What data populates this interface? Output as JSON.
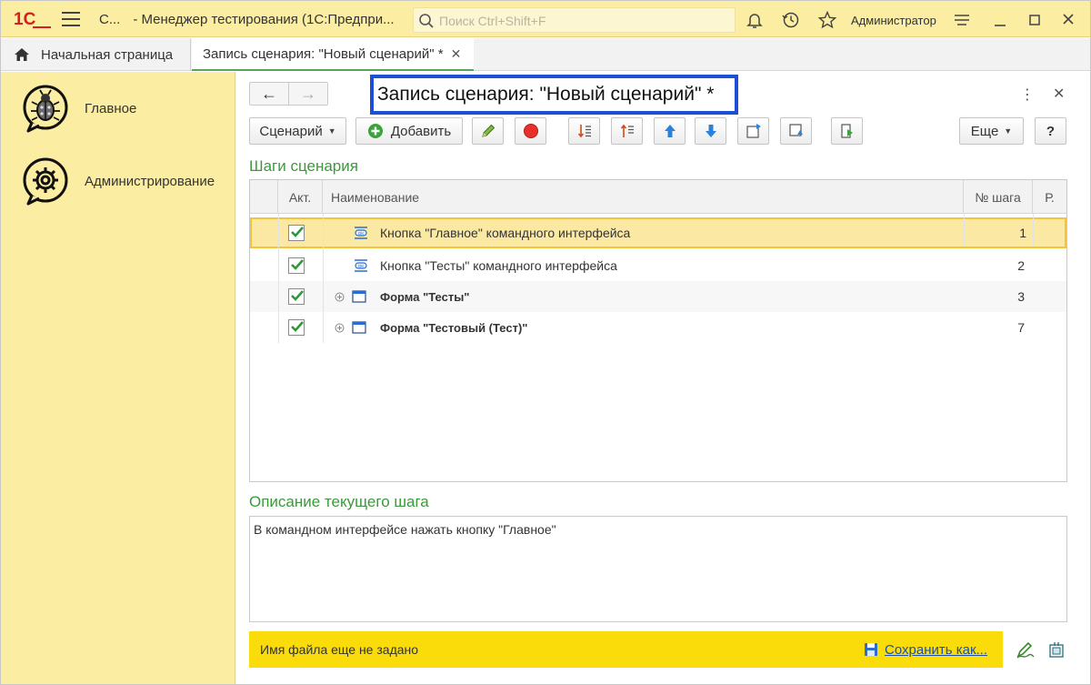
{
  "app": {
    "logo_text": "1С",
    "title_short": "С...",
    "title_main": "- Менеджер тестирования (1С:Предпри...",
    "search_placeholder": "Поиск Ctrl+Shift+F",
    "user": "Администратор",
    "accent_color": "#fbeda1"
  },
  "tabs": [
    {
      "label": "Начальная страница",
      "icon": "home-icon"
    },
    {
      "label": "Запись сценария: \"Новый сценарий\" *",
      "close": "✕",
      "active": true
    }
  ],
  "sidebar": {
    "items": [
      {
        "label": "Главное",
        "icon": "bug-icon"
      },
      {
        "label": "Администрирование",
        "icon": "gear-icon"
      }
    ]
  },
  "form": {
    "title": "Запись сценария: \"Новый сценарий\" *",
    "back": "←",
    "forward": "→",
    "more": "⋮",
    "close": "✕"
  },
  "toolbar": {
    "scenario_label": "Сценарий",
    "add_label": "Добавить",
    "more_label": "Еще",
    "help_label": "?"
  },
  "steps": {
    "section_title": "Шаги сценария",
    "columns": [
      "Акт.",
      "Наименование",
      "№ шага",
      "Р."
    ],
    "rows": [
      {
        "active": true,
        "name": "Кнопка \"Главное\" командного интерфейса",
        "step": "1",
        "type": "button",
        "bold": false,
        "expandable": false
      },
      {
        "active": true,
        "name": "Кнопка \"Тесты\" командного интерфейса",
        "step": "2",
        "type": "button",
        "bold": false,
        "expandable": false
      },
      {
        "active": true,
        "name": "Форма \"Тесты\"",
        "step": "3",
        "type": "form",
        "bold": true,
        "expandable": true
      },
      {
        "active": true,
        "name": "Форма \"Тестовый (Тест)\"",
        "step": "7",
        "type": "form",
        "bold": true,
        "expandable": true
      }
    ]
  },
  "description": {
    "section_title": "Описание текущего шага",
    "text": "В командном интерфейсе нажать кнопку \"Главное\""
  },
  "status": {
    "message": "Имя файла еще не задано",
    "save_label": "Сохранить как..."
  }
}
